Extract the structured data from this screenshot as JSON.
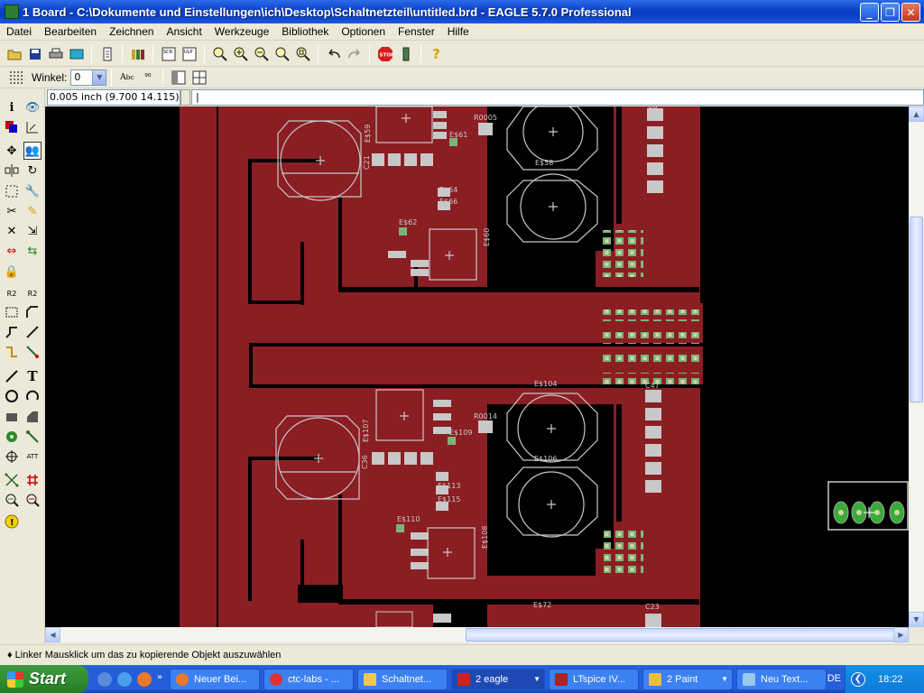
{
  "window": {
    "title": "1 Board - C:\\Dokumente und Einstellungen\\ich\\Desktop\\Schaltnetzteil\\untitled.brd - EAGLE 5.7.0 Professional",
    "buttons": {
      "minimize": "_",
      "maximize": "❐",
      "close": "✕"
    }
  },
  "menu": [
    "Datei",
    "Bearbeiten",
    "Zeichnen",
    "Ansicht",
    "Werkzeuge",
    "Bibliothek",
    "Optionen",
    "Fenster",
    "Hilfe"
  ],
  "toolbar": {
    "icons": [
      "open-icon",
      "save-icon",
      "print-icon",
      "cam-icon",
      "script-icon",
      "library-icon",
      "scr-icon",
      "ulp-icon",
      "zoom-fit-icon",
      "zoom-in-icon",
      "zoom-out-icon",
      "redraw-icon",
      "zoom-select-icon",
      "undo-icon",
      "redo-icon",
      "stop-icon",
      "drc-icon",
      "help-icon"
    ]
  },
  "params": {
    "angle_label": "Winkel:",
    "angle_value": "0"
  },
  "coordinates": "0.005 inch (9.700 14.115)",
  "command_line": "|",
  "status_text": "Linker Mausklick um das zu kopierende Objekt auszuwählen",
  "labels": {
    "r0005": "R0005",
    "c8": "C8",
    "e59": "E$59",
    "e61": "E$61",
    "e64": "E$64",
    "e66": "E$66",
    "e62": "E$62",
    "e60": "E$60",
    "c21": "C21",
    "r0014": "R0014",
    "e104": "E$104",
    "c47": "C47",
    "e107": "E$107",
    "e109": "E$109",
    "e106": "E$106",
    "e113": "E$113",
    "e115": "E$115",
    "e110": "E$110",
    "e108": "E$108",
    "c36": "C36",
    "e72": "E$72",
    "c23": "C23",
    "e58": "E$58"
  },
  "taskbar": {
    "start": "Start",
    "tasks": [
      "Neuer Bei...",
      "ctc-labs - ...",
      "Schaltnet...",
      "2 eagle",
      "LTspice IV...",
      "2 Paint",
      "Neu Text..."
    ],
    "language": "DE",
    "clock": "18:22"
  },
  "colors": {
    "board": "#8b1e23",
    "trace_cutout": "#000000",
    "pad": "#7ab37a",
    "outline": "#c8c8c8",
    "titlebar": "#0a3fc7"
  }
}
